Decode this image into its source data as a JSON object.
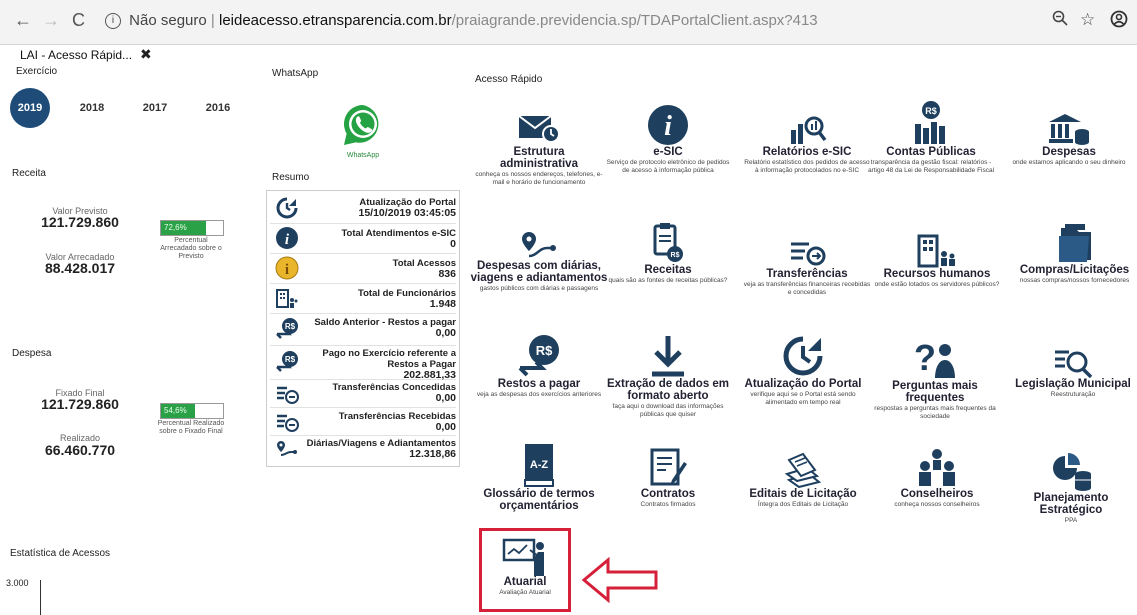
{
  "browser": {
    "back": "←",
    "forward": "→",
    "reload": "C",
    "security": "Não seguro",
    "url_host": "leideacesso.etransparencia.com.br",
    "url_path": "/praiagrande.previdencia.sp/TDAPortalClient.aspx?413",
    "zoom": "⊖",
    "star": "☆",
    "account": "⊖"
  },
  "tab": {
    "title": "LAI - Acesso Rápid...",
    "close": "✖"
  },
  "sections": {
    "exercicio": "Exercício",
    "whatsapp": "WhatsApp",
    "acesso_rapido": "Acesso Rápido",
    "receita": "Receita",
    "resumo": "Resumo",
    "despesa": "Despesa",
    "estatistica": "Estatística de Acessos"
  },
  "years": [
    "2019",
    "2018",
    "2017",
    "2016"
  ],
  "receita": {
    "previsto_label": "Valor Previsto",
    "previsto_value": "121.729.860",
    "arrecadado_label": "Valor Arrecadado",
    "arrecadado_value": "88.428.017",
    "progress_text": "72,6%",
    "progress_fraction": 0.726,
    "progress_caption": "Percentual Arrecadado sobre o Previsto"
  },
  "despesa": {
    "fixado_label": "Fixado Final",
    "fixado_value": "121.729.860",
    "realizado_label": "Realizado",
    "realizado_value": "66.460.770",
    "progress_text": "54,6%",
    "progress_fraction": 0.546,
    "progress_caption": "Percentual Realizado sobre o Fixado Final"
  },
  "estatistica": {
    "axis_top": "3.000"
  },
  "whatsapp_caption": "WhatsApp",
  "resumo_rows": [
    {
      "label": "Atualização do Portal",
      "value": "15/10/2019 03:45:05"
    },
    {
      "label": "Total Atendimentos e-SIC",
      "value": "0"
    },
    {
      "label": "Total Acessos",
      "value": "836"
    },
    {
      "label": "Total de Funcionários",
      "value": "1.948"
    },
    {
      "label": "Saldo Anterior - Restos a pagar",
      "value": "0,00"
    },
    {
      "label": "Pago no Exercício referente a Restos a Pagar",
      "value": "202.881,33"
    },
    {
      "label": "Transferências Concedidas",
      "value": "0,00"
    },
    {
      "label": "Transferências Recebidas",
      "value": "0,00"
    },
    {
      "label": "Diárias/Viagens e Adiantamentos",
      "value": "12.318,86"
    }
  ],
  "tiles": [
    {
      "title": "Estrutura administrativa",
      "desc": "conheça os nossos endereços, telefones, e-mail e horário de funcionamento"
    },
    {
      "title": "e-SIC",
      "desc": "Serviço de protocolo eletrônico de pedidos de acesso à informação pública"
    },
    {
      "title": "Relatórios e-SIC",
      "desc": "Relatório estatístico dos pedidos de acesso à informação protocolados no e-SIC"
    },
    {
      "title": "Contas Públicas",
      "desc": "transparência da gestão fiscal: relatórios - artigo 48 da Lei de Responsabilidade Fiscal"
    },
    {
      "title": "Despesas",
      "desc": "onde estamos aplicando o seu dinheiro"
    },
    {
      "title": "Despesas com diárias, viagens e adiantamentos",
      "desc": "gastos públicos com diárias e passagens"
    },
    {
      "title": "Receitas",
      "desc": "quais são as fontes de receitas públicas?"
    },
    {
      "title": "Transferências",
      "desc": "veja as transferências financeiras recebidas e concedidas"
    },
    {
      "title": "Recursos humanos",
      "desc": "onde estão lotados os servidores públicos?"
    },
    {
      "title": "Compras/Licitações",
      "desc": "nossas compras/nossos fornecedores"
    },
    {
      "title": "Restos a pagar",
      "desc": "veja as despesas dos exercícios anteriores"
    },
    {
      "title": "Extração de dados em formato aberto",
      "desc": "faça aqui o download das informações públicas que quiser"
    },
    {
      "title": "Atualização do Portal",
      "desc": "verifique aqui se o Portal está sendo alimentado em tempo real"
    },
    {
      "title": "Perguntas mais frequentes",
      "desc": "respostas a perguntas mais frequentes da sociedade"
    },
    {
      "title": "Legislação Municipal",
      "desc": "Reestruturação"
    },
    {
      "title": "Glossário de termos orçamentários",
      "desc": ""
    },
    {
      "title": "Contratos",
      "desc": "Contratos firmados"
    },
    {
      "title": "Editais de Licitação",
      "desc": "Íntegra dos Editais de Licitação"
    },
    {
      "title": "Conselheiros",
      "desc": "conheça nossos conselheiros"
    },
    {
      "title": "Planejamento Estratégico",
      "desc": "PPA"
    },
    {
      "title": "Atuarial",
      "desc": "Avaliação Atuarial"
    }
  ],
  "colors": {
    "brand": "#1f4b78",
    "progress": "#2aa146",
    "highlight": "#d6203a",
    "whatsapp": "#25a244"
  }
}
